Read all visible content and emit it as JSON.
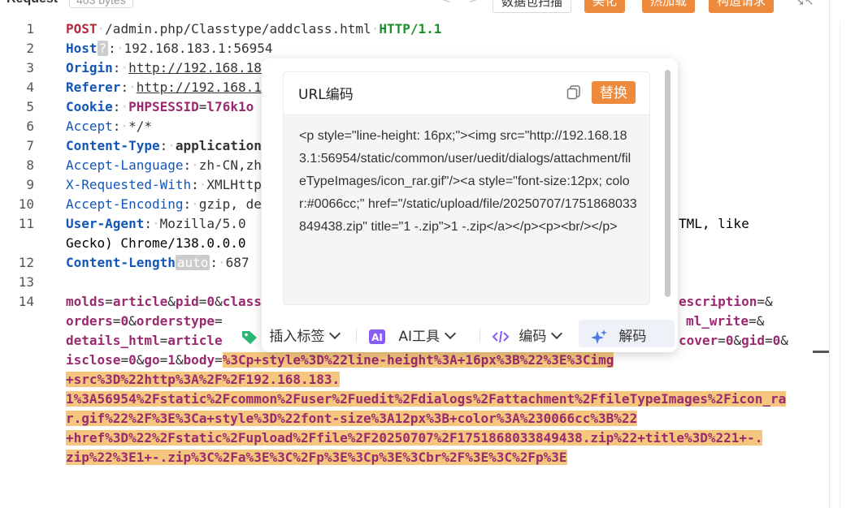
{
  "header": {
    "title": "Request",
    "size_badge": "403 bytes",
    "nav_prev": "<",
    "nav_next": ">",
    "buttons": [
      "数据包扫描",
      "美化",
      "热加载",
      "构造请求"
    ],
    "expand_icon": "↘↖"
  },
  "editor": {
    "line_numbers": [
      "1",
      "2",
      "3",
      "4",
      "5",
      "6",
      "7",
      "8",
      "9",
      "10",
      "11",
      "12",
      "13",
      "14"
    ],
    "request_line": {
      "method": "POST",
      "path": "/admin.php/Classtype/addclass.html",
      "version": "HTTP/1.1"
    },
    "headers": {
      "host": {
        "name": "Host",
        "badge": "?",
        "value": "192.168.183.1:56954"
      },
      "origin": {
        "name": "Origin",
        "value": "http://192.168.18"
      },
      "referer": {
        "name": "Referer",
        "value": "http://192.168.1"
      },
      "cookie": {
        "name": "Cookie",
        "key": "PHPSESSID",
        "value": "l76k1o"
      },
      "accept": {
        "name": "Accept",
        "value": "*/*"
      },
      "content_type": {
        "name": "Content-Type",
        "value": "application"
      },
      "accept_language": {
        "name": "Accept-Language",
        "value": "zh-CN,zh"
      },
      "x_requested_with": {
        "name": "X-Requested-With",
        "value": "XMLHttp"
      },
      "accept_encoding": {
        "name": "Accept-Encoding",
        "value": "gzip, de"
      },
      "user_agent": {
        "name": "User-Agent",
        "value": "Mozilla/5.0",
        "tail": "TML, like",
        "cont": "Gecko) Chrome/138.0.0.0"
      },
      "content_length": {
        "name": "Content-Length",
        "badge": "auto",
        "value": "687"
      }
    },
    "body": {
      "l1_a": "molds",
      "l1_b": "article",
      "l1_c": "pid",
      "l1_d": "0",
      "l1_e": "class",
      "l1_f": "escription",
      "l2_a": "orders",
      "l2_b": "0",
      "l2_c": "orderstype",
      "l2_f": "ml_write",
      "l3_a": "details_html",
      "l3_b": "article",
      "l3_f": "cover",
      "l3_g": "0",
      "l3_h": "gid",
      "l3_i": "0",
      "l4_a": "isclose",
      "l4_b": "0",
      "l4_c": "go",
      "l4_d": "1",
      "l4_e": "body",
      "enc1": "%3Cp+style%3D%22line-height%3A+16px%3B%22%3E%3Cimg",
      "enc2": "+src%3D%22http%3A%2F%2F192.168.183.",
      "enc3": "1%3A56954%2Fstatic%2Fcommon%2Fuser%2Fuedit%2Fdialogs%2Fattachment%2FfileTypeImages%2Ficon_ra",
      "enc4": "r.gif%22%2F%3E%3Ca+style%3D%22font-size%3A12px%3B+color%3A%230066cc%3B%22",
      "enc5": "+href%3D%22%2Fstatic%2Fupload%2Ffile%2F20250707%2F1751868033849438.zip%22+title%3D%221+-.",
      "enc6": "zip%22%3E1+-.zip%3C%2Fa%3E%3C%2Fp%3E%3Cp%3E%3Cbr%2F%3E%3C%2Fp%3E"
    }
  },
  "popup": {
    "title": "URL编码",
    "copy_icon": "copy-icon",
    "replace_label": "替换",
    "decoded_text": "<p style=\"line-height: 16px;\"><img src=\"http://192.168.183.1:56954/static/common/user/uedit/dialogs/attachment/fileTypeImages/icon_rar.gif\"/><a style=\"font-size:12px; color:#0066cc;\" href=\"/static/upload/file/20250707/1751868033849438.zip\" title=\"1 -.zip\">1 -.zip</a></p><p><br/></p>",
    "toolbar": {
      "insert_tag": "插入标签",
      "ai_tools": "AI工具",
      "encode": "编码",
      "decode": "解码"
    }
  },
  "colors": {
    "accent_orange": "#ee8a3c",
    "header_blue": "#1356b8",
    "method_red": "#b5283d",
    "param_purple": "#9a2a6f",
    "selection": "#f5c77e"
  }
}
